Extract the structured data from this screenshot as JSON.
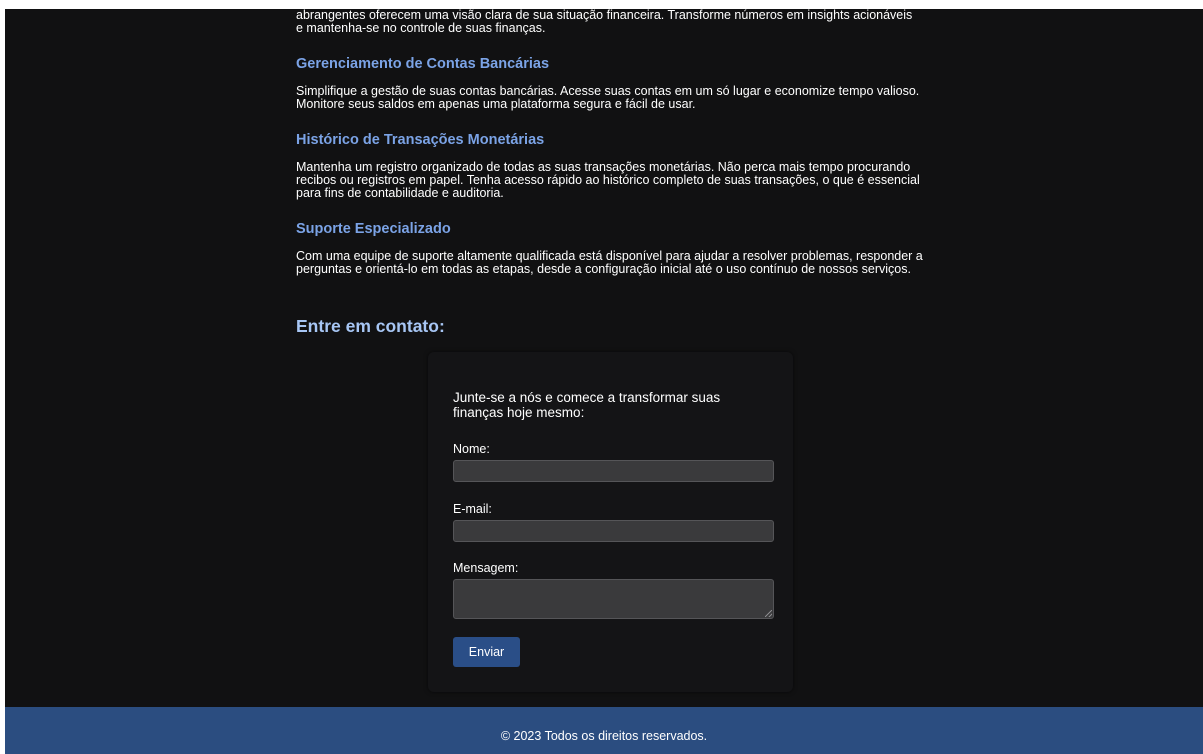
{
  "intro_tail": {
    "line1": "abrangentes oferecem uma visão clara de sua situação financeira. Transforme números em insights acionáveis",
    "line2": "e mantenha-se no controle de suas finanças."
  },
  "features": [
    {
      "title": "Gerenciamento de Contas Bancárias",
      "desc": "Simplifique a gestão de suas contas bancárias. Acesse suas contas em um só lugar e economize tempo valioso. Monitore seus saldos em apenas uma plataforma segura e fácil de usar."
    },
    {
      "title": "Histórico de Transações Monetárias",
      "desc": "Mantenha um registro organizado de todas as suas transações monetárias. Não perca mais tempo procurando recibos ou registros em papel. Tenha acesso rápido ao histórico completo de suas transações, o que é essencial para fins de contabilidade e auditoria."
    },
    {
      "title": "Suporte Especializado",
      "desc": "Com uma equipe de suporte altamente qualificada está disponível para ajudar a resolver problemas, responder a perguntas e orientá-lo em todas as etapas, desde a configuração inicial até o uso contínuo de nossos serviços."
    }
  ],
  "contact": {
    "heading": "Entre em contato:",
    "intro": "Junte-se a nós e comece a transformar suas finanças hoje mesmo:",
    "name_label": "Nome:",
    "name_value": "",
    "email_label": "E-mail:",
    "email_value": "",
    "message_label": "Mensagem:",
    "message_value": "",
    "submit_label": "Enviar"
  },
  "footer": {
    "text": "© 2023 Todos os direitos reservados."
  },
  "colors": {
    "background": "#111112",
    "accent_text": "#7ba3e6",
    "heading_text": "#a7c6f4",
    "button": "#2a4e87",
    "footer": "#2b4d80",
    "input_bg": "#3a3a3c"
  }
}
